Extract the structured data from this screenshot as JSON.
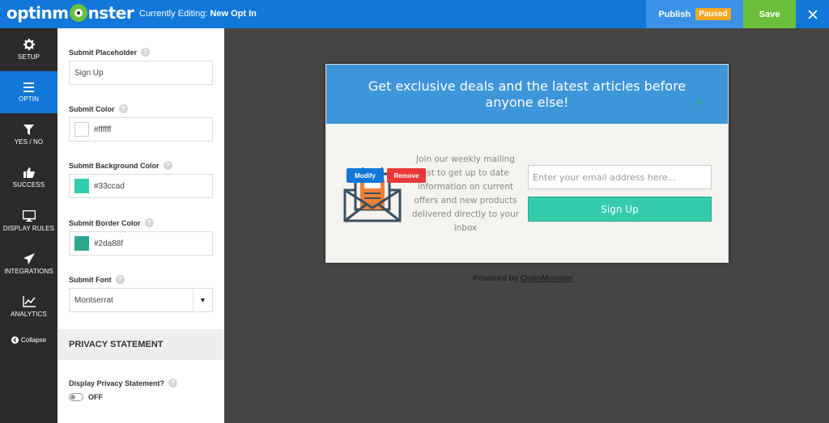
{
  "app": {
    "logo_text_a": "optinm",
    "logo_text_b": "nster",
    "editing_prefix": "Currently Editing:",
    "editing_name": "New Opt In"
  },
  "toolbar": {
    "publish_label": "Publish",
    "status_badge": "Paused",
    "save_label": "Save",
    "close_icon": "close-icon"
  },
  "nav": {
    "items": [
      {
        "label": "SETUP",
        "icon": "gear-icon"
      },
      {
        "label": "OPTIN",
        "icon": "hamburger-icon"
      },
      {
        "label": "YES / NO",
        "icon": "filter-icon"
      },
      {
        "label": "SUCCESS",
        "icon": "thumbs-up-icon"
      },
      {
        "label": "DISPLAY RULES",
        "icon": "monitor-icon"
      },
      {
        "label": "INTEGRATIONS",
        "icon": "paper-plane-icon"
      },
      {
        "label": "ANALYTICS",
        "icon": "line-chart-icon"
      }
    ],
    "active": "OPTIN",
    "collapse_label": "Collapse"
  },
  "panel": {
    "submit_placeholder": {
      "label": "Submit Placeholder",
      "value": "Sign Up"
    },
    "submit_color": {
      "label": "Submit Color",
      "value": "#ffffff"
    },
    "submit_bg_color": {
      "label": "Submit Background Color",
      "value": "#33ccad"
    },
    "submit_border_color": {
      "label": "Submit Border Color",
      "value": "#2da88f"
    },
    "submit_font": {
      "label": "Submit Font",
      "value": "Montserrat"
    },
    "privacy_header": "PRIVACY STATEMENT",
    "display_privacy": {
      "label": "Display Privacy Statement?",
      "state": "OFF"
    }
  },
  "preview": {
    "headline": "Get exclusive deals and the latest articles before anyone else!",
    "description": "Join our weekly mailing list to get up to date information on current offers and new products delivered directly to your inbox",
    "modify_label": "Modify",
    "remove_label": "Remove",
    "email_placeholder": "Enter your email address here...",
    "submit_label": "Sign Up",
    "powered_prefix": "Powered by",
    "powered_link": "OptinMonster"
  },
  "colors": {
    "topbar": "#1177d8",
    "save": "#6cbf3a",
    "badge": "#f6a623",
    "optin_header": "#3d95da",
    "submit_bg": "#33ccad",
    "submit_border": "#2da88f",
    "remove": "#e8393a"
  }
}
